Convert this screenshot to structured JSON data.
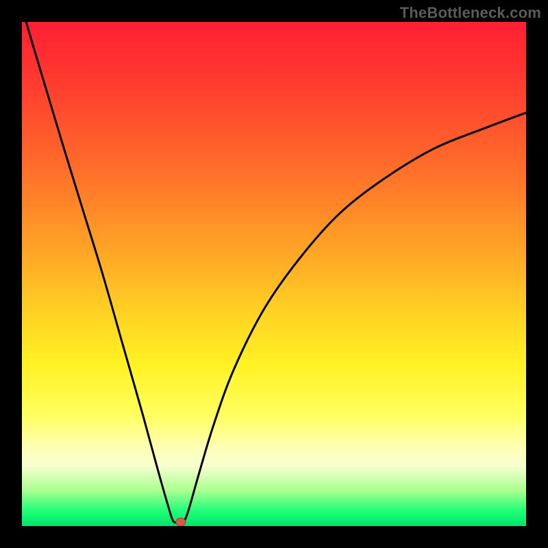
{
  "watermark": {
    "text": "TheBottleneck.com"
  },
  "colors": {
    "frame_bg": "#000000",
    "curve_stroke": "#000000",
    "marker_fill": "#d95a4a",
    "marker_stroke": "#a83b2d"
  },
  "chart_data": {
    "type": "line",
    "title": "",
    "xlabel": "",
    "ylabel": "",
    "xlim": [
      0,
      100
    ],
    "ylim": [
      0,
      100
    ],
    "grid": false,
    "legend": false,
    "series": [
      {
        "name": "bottleneck-curve",
        "x": [
          0,
          2,
          5,
          8,
          12,
          16,
          20,
          24,
          27,
          29,
          30,
          31,
          32,
          33,
          35,
          38,
          42,
          48,
          55,
          63,
          72,
          82,
          92,
          100
        ],
        "y": [
          103,
          96,
          86,
          76,
          63,
          50,
          36,
          22,
          11,
          4,
          1,
          0.8,
          0.8,
          3,
          10,
          20,
          31,
          43,
          53,
          62,
          69,
          75,
          79,
          82
        ]
      }
    ],
    "annotations": {
      "minimum_marker": {
        "x": 31.5,
        "y": 0.8,
        "shape": "ellipse"
      }
    }
  }
}
